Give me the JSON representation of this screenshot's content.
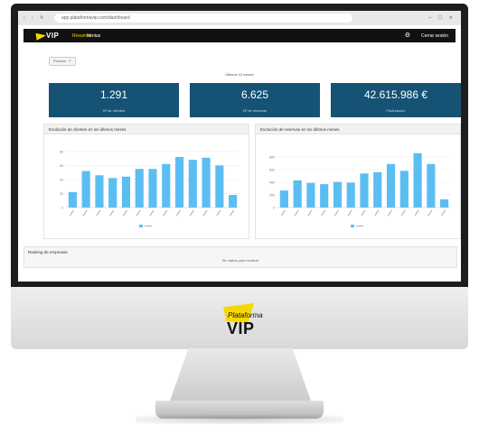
{
  "browser": {
    "url": "app.plataformavip.com/dashboard"
  },
  "app": {
    "logo_text": "VIP",
    "nav": [
      "Resumen",
      "Ventas"
    ],
    "user": "Cerrar sesión"
  },
  "filter": {
    "label": "Periodo",
    "close": "×"
  },
  "period_label": "Últimos 12 meses",
  "kpis": [
    {
      "value": "1.291",
      "label": "Nº de clientes"
    },
    {
      "value": "6.625",
      "label": "Nº de reservas"
    },
    {
      "value": "42.615.986 €",
      "label": "Facturación"
    }
  ],
  "charts": [
    {
      "title": "Evolución de clientes en los últimos meses",
      "chart_data": {
        "type": "bar",
        "title": "Evolución de clientes en los últimos meses",
        "categories": [
          "",
          "",
          "",
          "",
          "",
          "",
          "",
          "",
          "",
          "",
          "",
          "",
          "",
          ""
        ],
        "series": [
          {
            "values": [
              22,
              52,
              46,
              42,
              44,
              55,
              55,
              62,
              72,
              68,
              71,
              60,
              18
            ]
          }
        ],
        "ylim": [
          0,
          90
        ],
        "ticks": [
          0,
          20,
          40,
          60,
          80
        ],
        "bar_color": "#5bbef2",
        "legend": "bottom"
      }
    },
    {
      "title": "Evolución de reservas en los últimos meses",
      "chart_data": {
        "type": "bar",
        "title": "Evolución de reservas en los últimos meses",
        "categories": [
          "",
          "",
          "",
          "",
          "",
          "",
          "",
          "",
          "",
          "",
          "",
          "",
          "",
          ""
        ],
        "series": [
          {
            "values": [
              270,
              430,
              390,
              370,
              405,
              395,
              540,
              560,
              690,
              580,
              860,
              690,
              130
            ]
          }
        ],
        "ylim": [
          0,
          1000
        ],
        "ticks": [
          0,
          200,
          400,
          600,
          800
        ],
        "bar_color": "#5bbef2",
        "legend": "bottom"
      }
    }
  ],
  "table": {
    "title": "Ranking de empresas",
    "subtitle": "Sin datos para mostrar"
  },
  "chin": {
    "word": "Plataforma",
    "vip": "VIP"
  },
  "colors": {
    "kpi_bg": "#155274",
    "accent": "#f5d800",
    "bar": "#5bbef2",
    "appbar": "#111111"
  }
}
